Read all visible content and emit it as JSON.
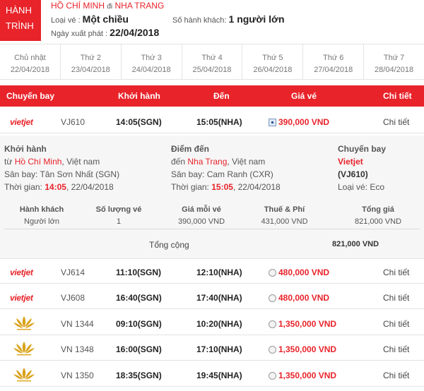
{
  "trip": {
    "badge_line1": "HÀNH",
    "badge_line2": "TRÌNH",
    "origin": "HỒ CHÍ MINH",
    "route_sep": "đi",
    "destination": "NHA TRANG",
    "ticket_type_label": "Loại vé :",
    "ticket_type": "Một chiều",
    "passengers_label": "Số hành khách:",
    "passengers": "1 người lớn",
    "departure_date_label": "Ngày xuất phát :",
    "departure_date": "22/04/2018"
  },
  "dates": [
    {
      "day": "Chủ nhật",
      "date": "22/04/2018"
    },
    {
      "day": "Thứ 2",
      "date": "23/04/2018"
    },
    {
      "day": "Thứ 3",
      "date": "24/04/2018"
    },
    {
      "day": "Thứ 4",
      "date": "25/04/2018"
    },
    {
      "day": "Thứ 5",
      "date": "26/04/2018"
    },
    {
      "day": "Thứ 6",
      "date": "27/04/2018"
    },
    {
      "day": "Thứ 7",
      "date": "28/04/2018"
    }
  ],
  "columns": {
    "flight": "Chuyến bay",
    "depart": "Khởi hành",
    "arrive": "Đến",
    "price": "Giá vé",
    "detail": "Chi tiết"
  },
  "selected_flight": {
    "airline_logo": "vietjet",
    "code": "VJ610",
    "depart": "14:05(SGN)",
    "arrive": "15:05(NHA)",
    "price": "390,000 VND",
    "detail": "Chi tiết"
  },
  "detail": {
    "origin_heading": "Khởi hành",
    "origin_from": "từ",
    "origin_city": "Hồ Chí Minh",
    "origin_country": ", Việt nam",
    "origin_airport_label": "Sân bay:",
    "origin_airport": "Tân Sơn Nhất (SGN)",
    "origin_time_label": "Thời gian:",
    "origin_time": "14:05",
    "origin_date": ", 22/04/2018",
    "dest_heading": "Điểm đến",
    "dest_to": "đến",
    "dest_city": "Nha Trang",
    "dest_country": ", Việt nam",
    "dest_airport_label": "Sân bay:",
    "dest_airport": "Cam Ranh (CXR)",
    "dest_time_label": "Thời gian:",
    "dest_time": "15:05",
    "dest_date": ", 22/04/2018",
    "flight_heading": "Chuyến bay",
    "airline": "Vietjet",
    "flight_code": "(VJ610)",
    "fare_class_label": "Loại vé:",
    "fare_class": "Eco",
    "fare_headers": [
      "Hành khách",
      "Số lượng vé",
      "Giá mỗi vé",
      "Thuế & Phí",
      "Tổng giá"
    ],
    "fare_row": [
      "Người lớn",
      "1",
      "390,000 VND",
      "431,000 VND",
      "821,000 VND"
    ],
    "total_label": "Tổng cộng",
    "total_value": "821,000 VND"
  },
  "flights": [
    {
      "airline_logo": "vietjet",
      "code": "VJ614",
      "depart": "11:10(SGN)",
      "arrive": "12:10(NHA)",
      "price": "480,000 VND",
      "detail": "Chi tiết"
    },
    {
      "airline_logo": "vietjet",
      "code": "VJ608",
      "depart": "16:40(SGN)",
      "arrive": "17:40(NHA)",
      "price": "480,000 VND",
      "detail": "Chi tiết"
    },
    {
      "airline_logo": "vietnam-airlines-lotus",
      "code": "VN 1344",
      "depart": "09:10(SGN)",
      "arrive": "10:20(NHA)",
      "price": "1,350,000 VND",
      "detail": "Chi tiết"
    },
    {
      "airline_logo": "vietnam-airlines-lotus",
      "code": "VN 1348",
      "depart": "16:00(SGN)",
      "arrive": "17:10(NHA)",
      "price": "1,350,000 VND",
      "detail": "Chi tiết"
    },
    {
      "airline_logo": "vietnam-airlines-lotus",
      "code": "VN 1350",
      "depart": "18:35(SGN)",
      "arrive": "19:45(NHA)",
      "price": "1,350,000 VND",
      "detail": "Chi tiết"
    }
  ],
  "vietjet_logo_text": "vietjet",
  "colors": {
    "accent": "#e8232a",
    "lotus": "#d9a21b"
  }
}
